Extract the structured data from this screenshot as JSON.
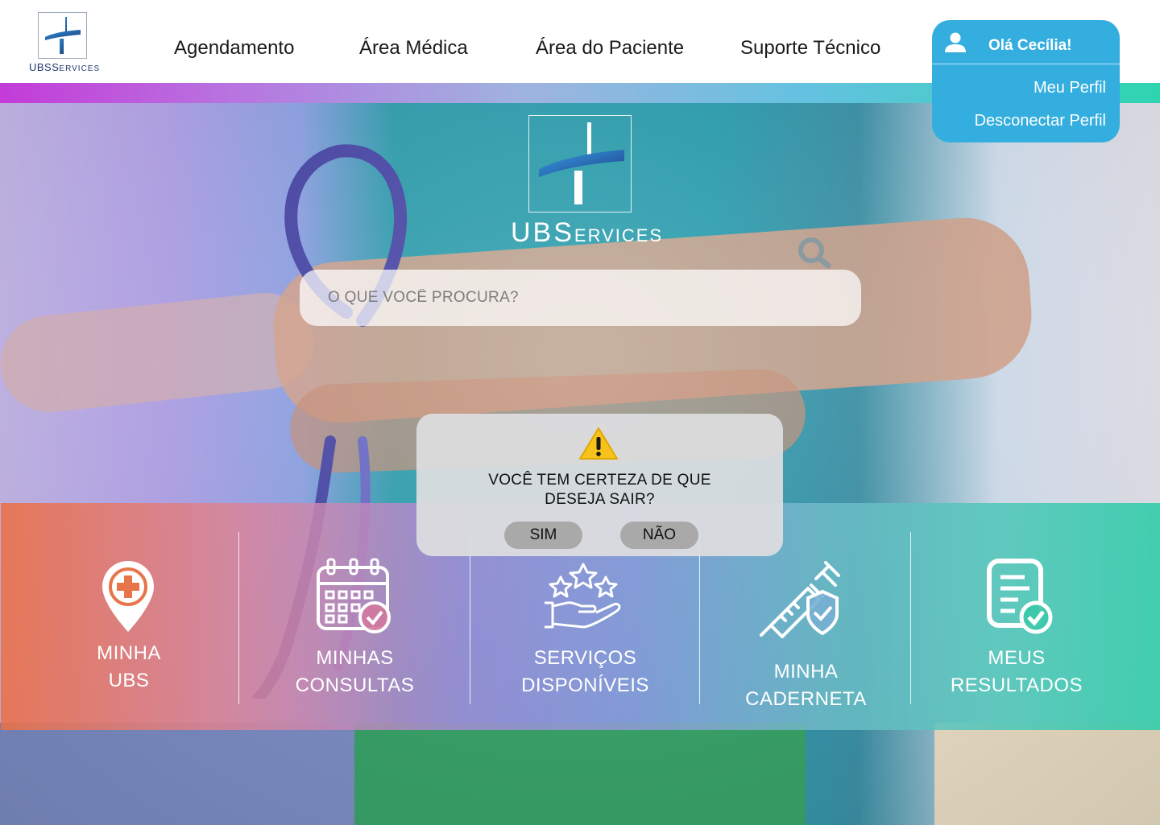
{
  "header": {
    "logo": {
      "text_main": "UBS",
      "text_small": "ERVICES",
      "text_s": "S"
    },
    "nav": [
      {
        "label": "Agendamento"
      },
      {
        "label": "Área Médica"
      },
      {
        "label": "Área do Paciente"
      },
      {
        "label": "Suporte Técnico"
      }
    ]
  },
  "user_menu": {
    "greeting": "Olá Cecília!",
    "items": [
      {
        "label": "Meu Perfil"
      },
      {
        "label": "Desconectar Perfil"
      }
    ],
    "color": "#33aede"
  },
  "hero": {
    "logo": {
      "text_main": "UBS",
      "text_small": "ERVICES"
    },
    "search": {
      "placeholder": "O QUE VOCÊ PROCURA?"
    }
  },
  "cards": [
    {
      "line1": "MINHA",
      "line2": "UBS",
      "icon": "map-pin-plus-icon"
    },
    {
      "line1": "MINHAS",
      "line2": "CONSULTAS",
      "icon": "calendar-check-icon"
    },
    {
      "line1": "SERVIÇOS",
      "line2": "DISPONÍVEIS",
      "icon": "hand-stars-icon"
    },
    {
      "line1": "MINHA",
      "line2": "CADERNETA",
      "icon": "syringe-shield-icon"
    },
    {
      "line1": "MEUS",
      "line2": "RESULTADOS",
      "icon": "document-check-icon"
    }
  ],
  "modal": {
    "icon": "warning-icon",
    "line1": "VOCÊ TEM CERTEZA DE QUE",
    "line2": "DESEJA SAIR?",
    "yes_label": "SIM",
    "no_label": "NÃO"
  },
  "colors": {
    "brand_blue": "#1e3a6e",
    "accent_cyan": "#33aede",
    "warning_yellow": "#f7c21a"
  }
}
